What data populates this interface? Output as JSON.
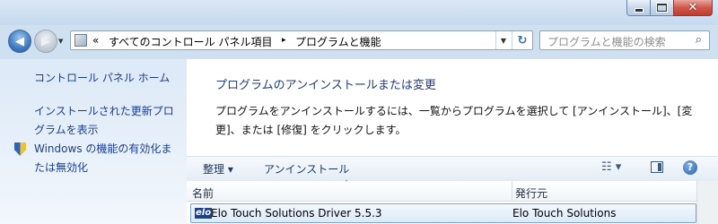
{
  "window": {
    "minimize_icon": "minimize-icon",
    "maximize_icon": "maximize-icon",
    "close_icon": "close-icon",
    "close_glyph": "✕"
  },
  "navigation": {
    "back_glyph": "◀",
    "forward_glyph": "▶",
    "history_glyph": "▼",
    "breadcrumb": {
      "overflow": "«",
      "crumbs": [
        "すべてのコントロール パネル項目",
        "プログラムと機能"
      ],
      "separator": "▸"
    },
    "refresh_glyph": "↻",
    "search_placeholder": "プログラムと機能の検索",
    "search_glyph": "⌕"
  },
  "sidebar": {
    "items": [
      "コントロール パネル ホーム",
      "インストールされた更新プログラムを表示",
      "Windows の機能の有効化または無効化"
    ]
  },
  "main": {
    "title": "プログラムのアンインストールまたは変更",
    "description": "プログラムをアンインストールするには、一覧からプログラムを選択して [アンインストール]、[変更]、または [修復] をクリックします。"
  },
  "toolbar": {
    "organize": "整理 ▾",
    "uninstall": "アンインストール",
    "view_glyph": "☷ ▾",
    "help_glyph": "?"
  },
  "list": {
    "sort_glyph": "˄",
    "columns": [
      "名前",
      "発行元"
    ],
    "rows": [
      {
        "logo": "elo",
        "name": "Elo Touch Solutions Driver 5.5.3",
        "publisher": "Elo Touch Solutions"
      }
    ]
  },
  "colors": {
    "link": "#1a3e8e",
    "title_blue": "#1e3a8a",
    "selection": "#dbeaf9",
    "close_red": "#c03c2c"
  }
}
